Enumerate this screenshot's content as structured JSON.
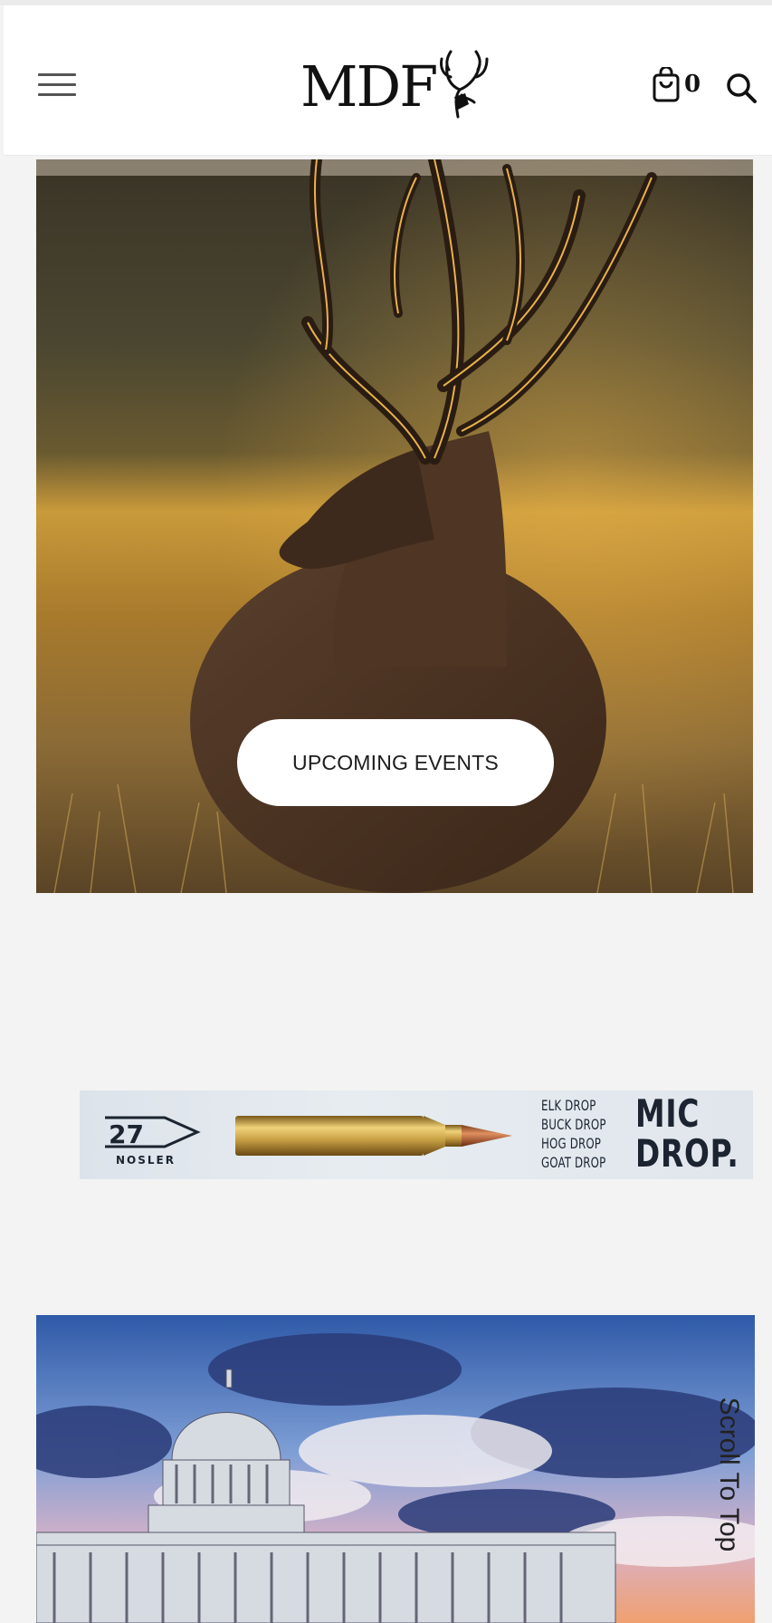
{
  "header": {
    "logo_text": "MDF",
    "cart_count": "0",
    "icons": {
      "menu": "hamburger-menu-icon",
      "logo_mark": "deer-antler-logo-icon",
      "cart": "shopping-bag-icon",
      "search": "search-icon"
    }
  },
  "events": {
    "button_label": "UPCOMING EVENTS",
    "image": "mule-deer-in-golden-field-photo"
  },
  "ad": {
    "brand": "NOSLER",
    "brand_mark": "27",
    "drops": [
      "ELK DROP",
      "BUCK DROP",
      "HOG DROP",
      "GOAT DROP"
    ],
    "headline_line1": "MIC",
    "headline_line2": "DROP."
  },
  "capitol": {
    "image": "capitol-building-sky-photo"
  },
  "scroll_to_top": "Scroll To Top",
  "colors": {
    "page_bg": "#f3f3f3",
    "header_bg": "#ffffff",
    "ad_text": "#1b2430"
  }
}
